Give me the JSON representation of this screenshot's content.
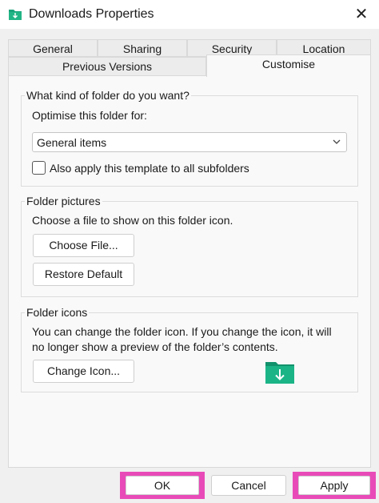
{
  "window": {
    "title": "Downloads Properties",
    "close_glyph": "✕",
    "title_icon": "downloads-folder-icon"
  },
  "tabs": {
    "row1": [
      "General",
      "Sharing",
      "Security",
      "Location"
    ],
    "row2": [
      "Previous Versions",
      "Customise"
    ],
    "active": "Customise"
  },
  "folder_type": {
    "heading": "What kind of folder do you want?",
    "optimise_label": "Optimise this folder for:",
    "selected": "General items",
    "apply_all_label": "Also apply this template to all subfolders",
    "apply_all_checked": false
  },
  "folder_pictures": {
    "heading": "Folder pictures",
    "description": "Choose a file to show on this folder icon.",
    "choose_file": "Choose File...",
    "restore_default": "Restore Default"
  },
  "folder_icons": {
    "heading": "Folder icons",
    "description_line1": "You can change the folder icon. If you change the icon, it will",
    "description_line2": "no longer show a preview of the folder’s contents.",
    "change_icon": "Change Icon...",
    "preview_icon": "downloads-folder-icon"
  },
  "footer": {
    "ok": "OK",
    "cancel": "Cancel",
    "apply": "Apply",
    "highlight_color": "#e84bb8"
  },
  "colors": {
    "accent": "#1aa37a",
    "accent_dark": "#0f7a5c"
  }
}
